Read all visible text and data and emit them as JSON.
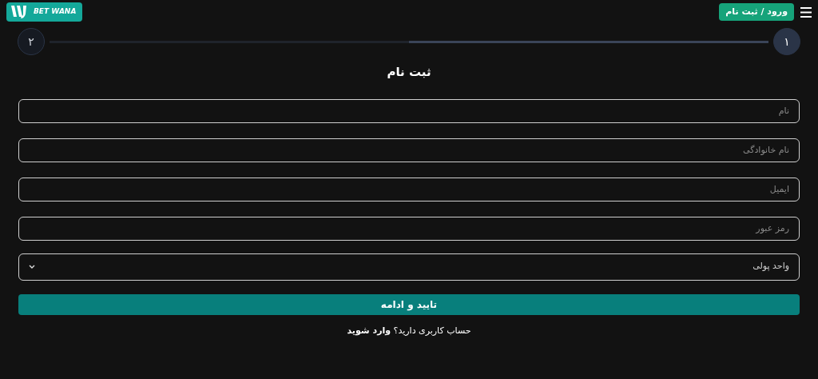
{
  "header": {
    "logo_text": "BET WANA",
    "login_button": "ورود / ثبت نام"
  },
  "stepper": {
    "level": 0.5,
    "steps": [
      {
        "label": "۱",
        "selected": true
      },
      {
        "label": "۲",
        "selected": false
      }
    ]
  },
  "title": "ثبت نام",
  "fields": [
    {
      "kind": "input",
      "placeholder": "نام"
    },
    {
      "kind": "input",
      "placeholder": "نام خانوادگی"
    },
    {
      "kind": "input",
      "placeholder": "ایمیل"
    },
    {
      "kind": "input",
      "placeholder": "رمز عبور"
    },
    {
      "kind": "select",
      "value": "واحد پولی"
    }
  ],
  "submit": "تایید و ادامه",
  "footer": {
    "prompt": "حساب کاربری دارید؟",
    "link": "وارد شوید"
  }
}
